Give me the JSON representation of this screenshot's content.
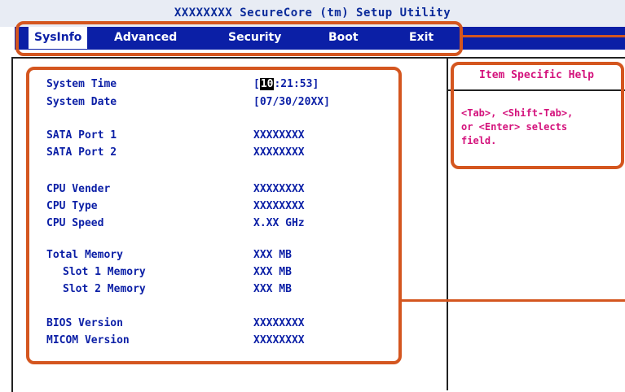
{
  "window": {
    "title": "XXXXXXXX SecureCore (tm) Setup Utility"
  },
  "menu": {
    "tabs": [
      {
        "label": "SysInfo",
        "active": true
      },
      {
        "label": "Advanced",
        "active": false
      },
      {
        "label": "Security",
        "active": false
      },
      {
        "label": "Boot",
        "active": false
      },
      {
        "label": "Exit",
        "active": false
      }
    ]
  },
  "sysinfo": {
    "system_time": {
      "label": "System Time",
      "value_open": "[",
      "cursor": "10",
      "value_rest": ":21:53]"
    },
    "system_date": {
      "label": "System Date",
      "value": "[07/30/20XX]"
    },
    "sata_port_1": {
      "label": "SATA Port 1",
      "value": "XXXXXXXX"
    },
    "sata_port_2": {
      "label": "SATA Port 2",
      "value": "XXXXXXXX"
    },
    "cpu_vender": {
      "label": "CPU Vender",
      "value": "XXXXXXXX"
    },
    "cpu_type": {
      "label": "CPU Type",
      "value": "XXXXXXXX"
    },
    "cpu_speed": {
      "label": "CPU Speed",
      "value": "X.XX GHz"
    },
    "total_memory": {
      "label": "Total Memory",
      "value": "XXX MB"
    },
    "slot_1_memory": {
      "label": "Slot 1 Memory",
      "value": "XXX MB"
    },
    "slot_2_memory": {
      "label": "Slot 2 Memory",
      "value": "XXX MB"
    },
    "bios_version": {
      "label": "BIOS Version",
      "value": "XXXXXXXX"
    },
    "micom_version": {
      "label": "MICOM Version",
      "value": "XXXXXXXX"
    }
  },
  "help": {
    "title": "Item Specific Help",
    "text": "<Tab>, <Shift-Tab>,\nor <Enter> selects\nfield."
  },
  "colors": {
    "menu_bg": "#0b1fa6",
    "text_blue": "#0b1fa6",
    "help_magenta": "#d4127c",
    "annotation_orange": "#d4561f"
  }
}
